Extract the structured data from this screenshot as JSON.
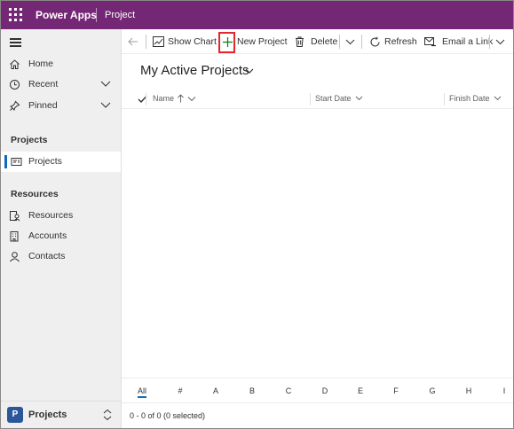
{
  "topbar": {
    "brand": "Power Apps",
    "app_name": "Project"
  },
  "sidebar": {
    "items": [
      {
        "label": "Home",
        "icon": "home-icon"
      },
      {
        "label": "Recent",
        "icon": "clock-icon"
      },
      {
        "label": "Pinned",
        "icon": "pin-icon"
      }
    ],
    "sections": [
      {
        "title": "Projects",
        "items": [
          {
            "label": "Projects",
            "icon": "projects-icon",
            "selected": true
          }
        ]
      },
      {
        "title": "Resources",
        "items": [
          {
            "label": "Resources",
            "icon": "resources-icon"
          },
          {
            "label": "Accounts",
            "icon": "accounts-icon"
          },
          {
            "label": "Contacts",
            "icon": "contacts-icon"
          }
        ]
      }
    ],
    "footer": {
      "badge": "P",
      "label": "Projects"
    }
  },
  "commandbar": {
    "show_chart": "Show Chart",
    "new_project": "New Project",
    "delete": "Delete",
    "refresh": "Refresh",
    "email_link": "Email a Link"
  },
  "view": {
    "title": "My Active Projects"
  },
  "grid": {
    "columns": [
      "Name",
      "Start Date",
      "Finish Date"
    ],
    "rows": []
  },
  "jumpbar": {
    "letters": [
      "All",
      "#",
      "A",
      "B",
      "C",
      "D",
      "E",
      "F",
      "G",
      "H",
      "I"
    ],
    "active": "All"
  },
  "status": {
    "text": "0 - 0 of 0 (0 selected)"
  },
  "colors": {
    "topbar": "#742774",
    "accent": "#0f6cbd",
    "new_icon": "#107c10",
    "highlight": "#e0282e"
  }
}
